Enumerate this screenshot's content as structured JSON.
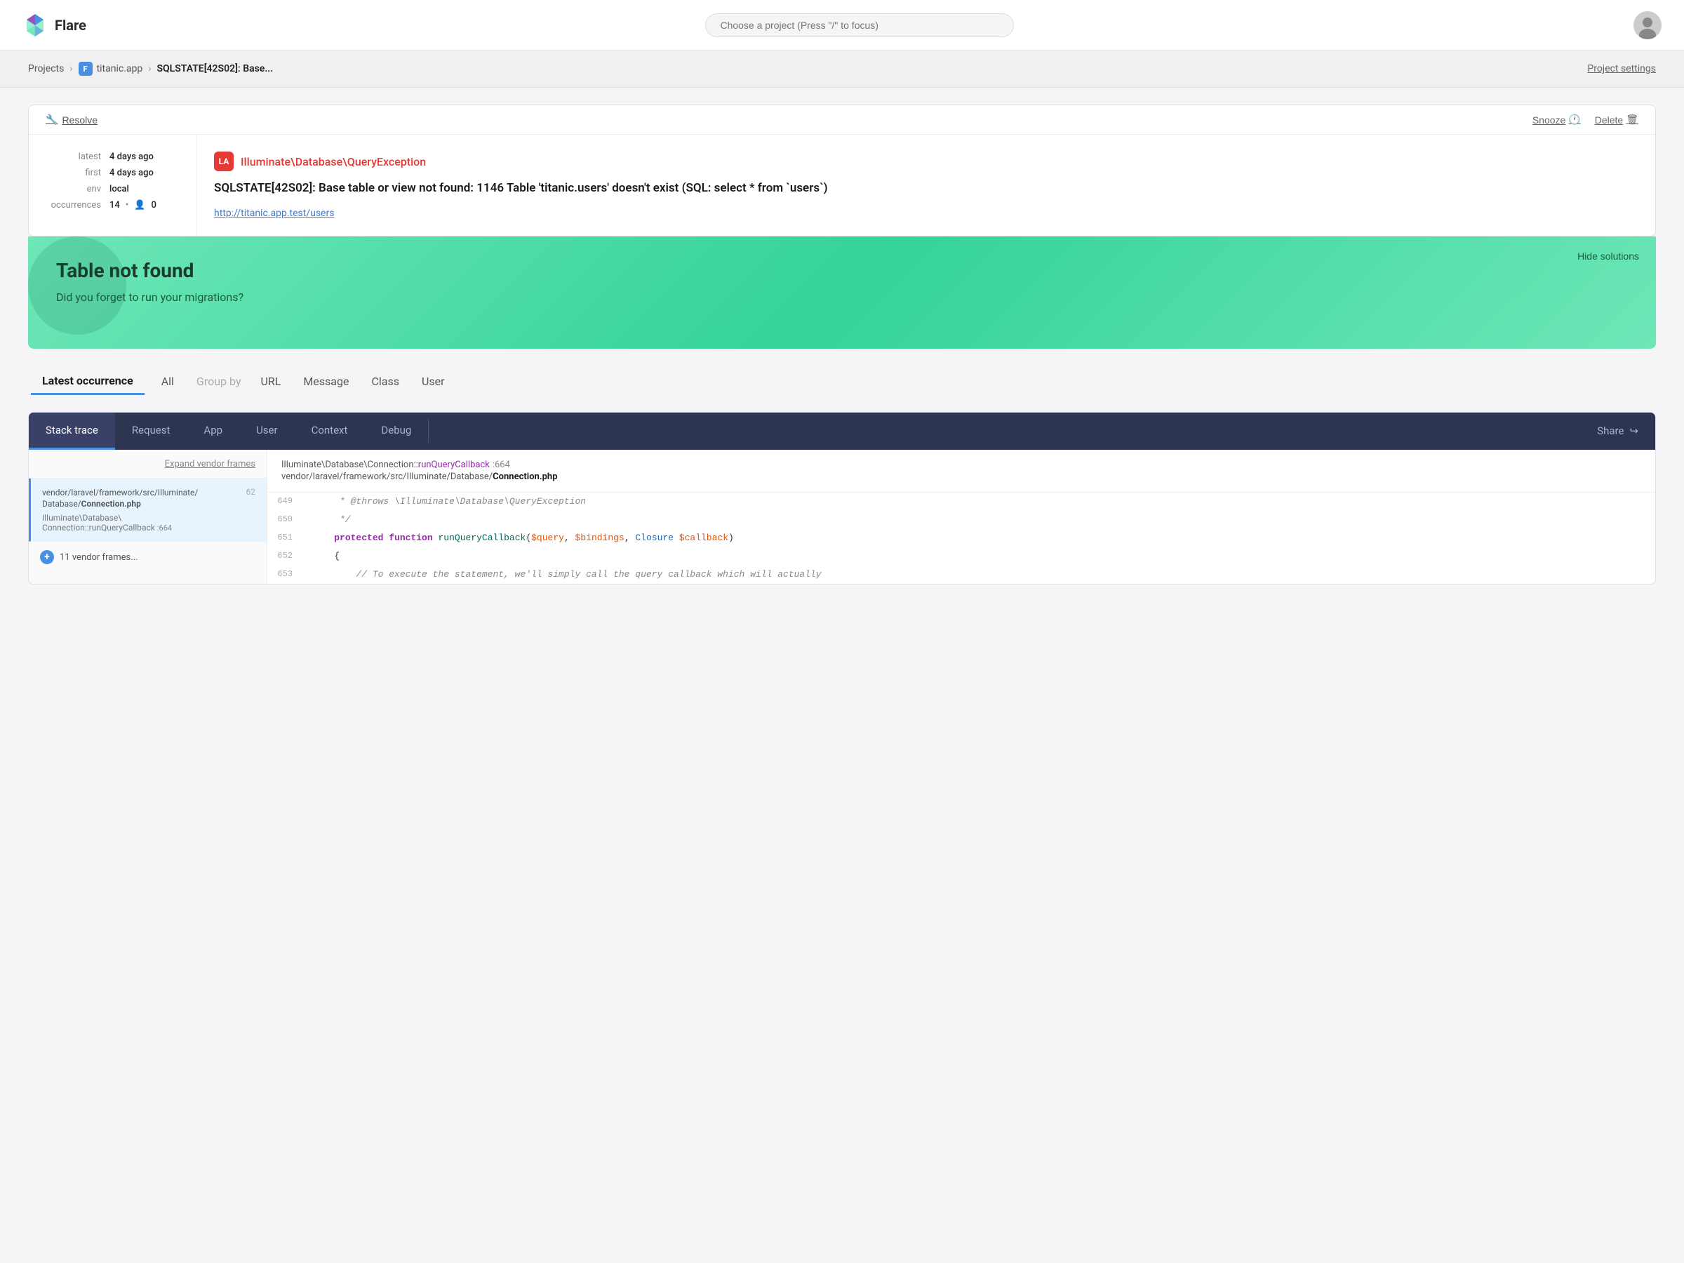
{
  "app": {
    "logo_text": "Flare",
    "search_placeholder": "Choose a project (Press \"/\" to focus)"
  },
  "breadcrumb": {
    "projects_label": "Projects",
    "project_name": "titanic.app",
    "project_initial": "F",
    "current_page": "SQLSTATE[42S02]: Base...",
    "project_settings_label": "Project settings"
  },
  "toolbar": {
    "resolve_label": "Resolve",
    "snooze_label": "Snooze",
    "delete_label": "Delete"
  },
  "error_meta": {
    "latest_label": "latest",
    "latest_value": "4 days ago",
    "first_label": "first",
    "first_value": "4 days ago",
    "env_label": "env",
    "env_value": "local",
    "occurrences_label": "occurrences",
    "occurrences_count": "14",
    "occurrences_users": "0"
  },
  "exception": {
    "class": "Illuminate\\Database\\QueryException",
    "icon_label": "LA",
    "message": "SQLSTATE[42S02]: Base table or view not found: 1146 Table 'titanic.users' doesn't exist (SQL: select * from `users`)",
    "url": "http://titanic.app.test/users"
  },
  "solution": {
    "hide_label": "Hide solutions",
    "title": "Table not found",
    "text": "Did you forget to run your migrations?"
  },
  "tabs": {
    "latest_occurrence": "Latest occurrence",
    "all": "All",
    "group_by": "Group by",
    "url": "URL",
    "message": "Message",
    "class": "Class",
    "user": "User"
  },
  "code_panel": {
    "tabs": [
      "Stack trace",
      "Request",
      "App",
      "User",
      "Context",
      "Debug"
    ],
    "share_label": "Share",
    "active_tab": "Stack trace",
    "expand_vendor": "Expand vendor frames",
    "breadcrumb_class": "Illuminate\\Database\\Connection",
    "breadcrumb_method": "::runQueryCallback",
    "breadcrumb_line": ":664",
    "breadcrumb_file": "vendor/laravel/framework/src/Illuminate/Database/",
    "breadcrumb_file_bold": "Connection.php"
  },
  "frames": [
    {
      "path": "vendor/laravel/framework/src/Illuminate/\nDatabase/Connection.php",
      "path_bold": "Connection.php",
      "method": "Illuminate\\Database\\\nConnection::runQueryCallback",
      "line": ":664",
      "number": "62",
      "active": true
    }
  ],
  "vendor_frames": {
    "count": "11",
    "label": "11 vendor frames..."
  },
  "code_lines": [
    {
      "num": "649",
      "content": "     * @throws \\Illuminate\\Database\\QueryException",
      "type": "comment"
    },
    {
      "num": "650",
      "content": "     */",
      "type": "comment"
    },
    {
      "num": "651",
      "content": "    protected function runQueryCallback($query, $bindings, Closure $callback)",
      "type": "code"
    },
    {
      "num": "652",
      "content": "    {",
      "type": "code"
    },
    {
      "num": "653",
      "content": "        // To execute the statement, we'll simply call the query callback which will actually",
      "type": "comment"
    }
  ]
}
